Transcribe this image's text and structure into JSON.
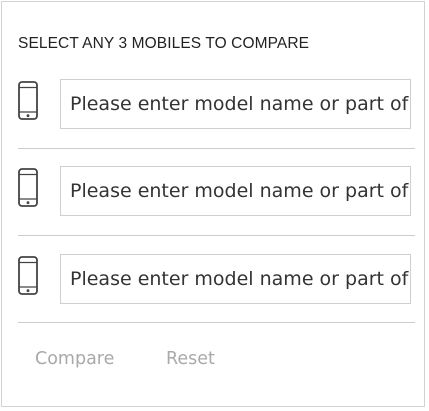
{
  "heading": "SELECT ANY 3 MOBILES TO COMPARE",
  "slots": [
    {
      "icon": "mobile-phone-icon",
      "placeholder": "Please enter model name or part of it",
      "value": ""
    },
    {
      "icon": "mobile-phone-icon",
      "placeholder": "Please enter model name or part of it",
      "value": ""
    },
    {
      "icon": "mobile-phone-icon",
      "placeholder": "Please enter model name or part of it",
      "value": ""
    }
  ],
  "actions": {
    "compare_label": "Compare",
    "reset_label": "Reset"
  },
  "colors": {
    "border": "#d2d2d2",
    "text": "#222222",
    "disabled_action": "#a9a9a9"
  }
}
